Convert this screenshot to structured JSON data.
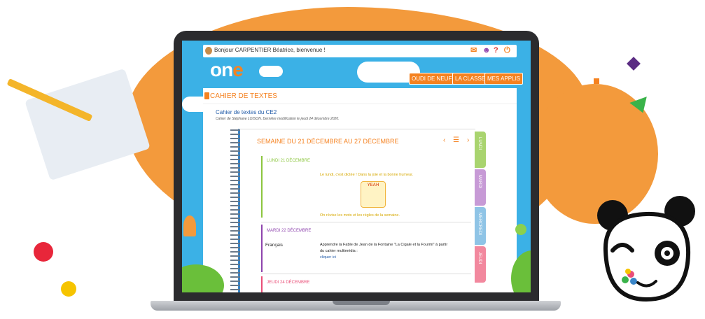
{
  "header": {
    "greeting": "Bonjour CARPENTIER Béatrice, bienvenue !",
    "nav": [
      "OUDI DE NEUF ?",
      "LA CLASSE",
      "MES APPLIS"
    ]
  },
  "logo": {
    "text_1": "on",
    "text_2": "e"
  },
  "panel": {
    "title": "CAHIER DE TEXTES",
    "cahier_title": "Cahier de textes du CE2",
    "cahier_subtitle": "Cahier de Stéphane LOISON. Dernière modification le jeudi 24 décembre 2020."
  },
  "week": {
    "title": "SEMAINE DU 21 DÉCEMBRE AU 27 DÉCEMBRE",
    "prev": "‹",
    "menu": "☰",
    "next": "›"
  },
  "days": [
    {
      "label": "LUNDI 21 DÉCEMBRE",
      "line1": "Le lundi, c'est dictée ! Dans la joie et la bonne humeur.",
      "image_text": "YEAH",
      "line2": "On révise les mots et les règles de la semaine."
    },
    {
      "label": "MARDI 22 DÉCEMBRE",
      "subject": "Français",
      "line1": "Apprendre la Fable de Jean de la Fontaine \"La Cigale et la Fourmi\" à partir",
      "line2": "du cahier multimédia :",
      "link": "cliquer ici"
    },
    {
      "label": "JEUDI 24 DÉCEMBRE"
    }
  ],
  "tabs": [
    "LUNDI",
    "MARDI",
    "MERCREDI",
    "JEUDI"
  ],
  "colors": {
    "orange": "#f58220",
    "green": "#8cc63f",
    "purple": "#8e44ad",
    "pink": "#e94e77",
    "blue": "#3a86c8"
  }
}
